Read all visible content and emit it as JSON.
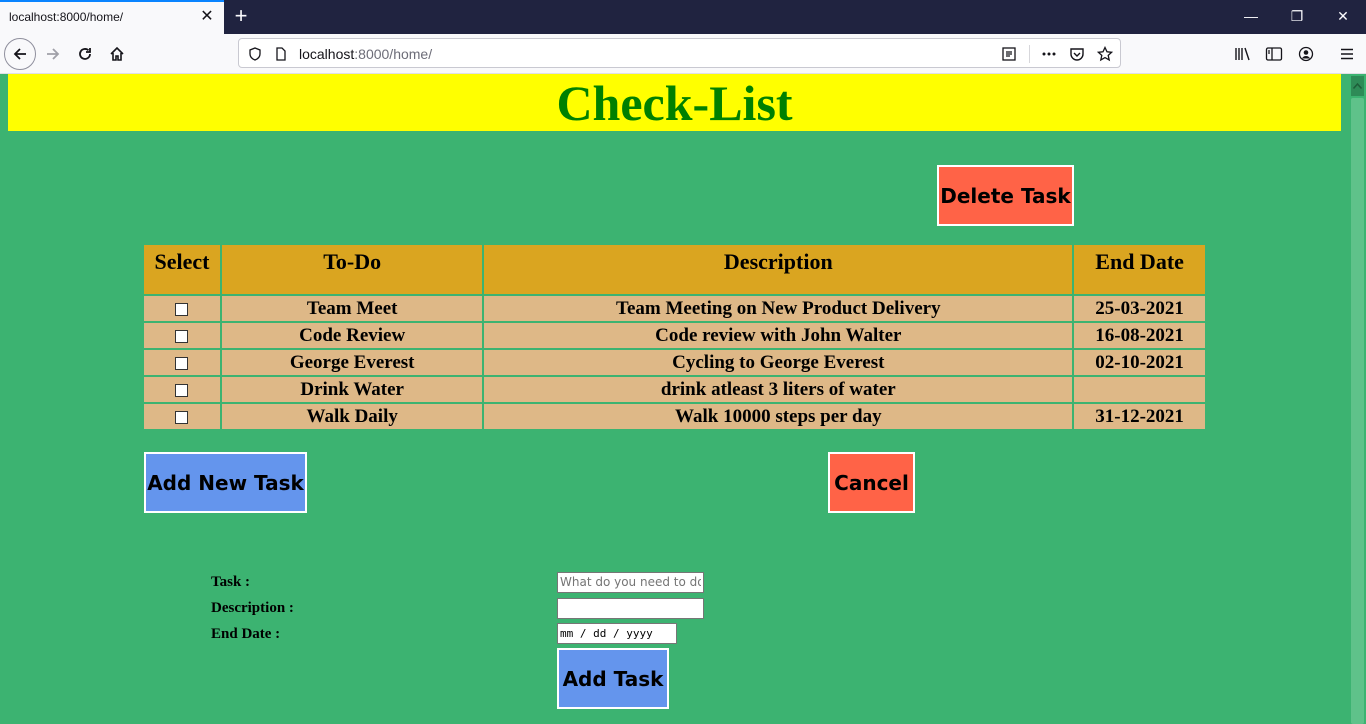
{
  "browser": {
    "tab_title": "localhost:8000/home/",
    "url_host": "localhost",
    "url_rest": ":8000/home/"
  },
  "page": {
    "title": "Check-List",
    "delete_button": "Delete Task",
    "add_new_button": "Add New Task",
    "cancel_button": "Cancel"
  },
  "table": {
    "headers": {
      "select": "Select",
      "todo": "To-Do",
      "description": "Description",
      "end_date": "End Date"
    },
    "rows": [
      {
        "todo": "Team Meet",
        "description": "Team Meeting on New Product Delivery",
        "end_date": "25-03-2021"
      },
      {
        "todo": "Code Review",
        "description": "Code review with John Walter",
        "end_date": "16-08-2021"
      },
      {
        "todo": "George Everest",
        "description": "Cycling to George Everest",
        "end_date": "02-10-2021"
      },
      {
        "todo": "Drink Water",
        "description": "drink atleast 3 liters of water",
        "end_date": ""
      },
      {
        "todo": "Walk Daily",
        "description": "Walk 10000 steps per day",
        "end_date": "31-12-2021"
      }
    ]
  },
  "form": {
    "task_label": "Task :",
    "task_placeholder": "What do you need to do?",
    "description_label": "Description :",
    "end_date_label": "End Date :",
    "end_date_placeholder": "mm / dd / yyyy",
    "submit_label": "Add Task"
  }
}
